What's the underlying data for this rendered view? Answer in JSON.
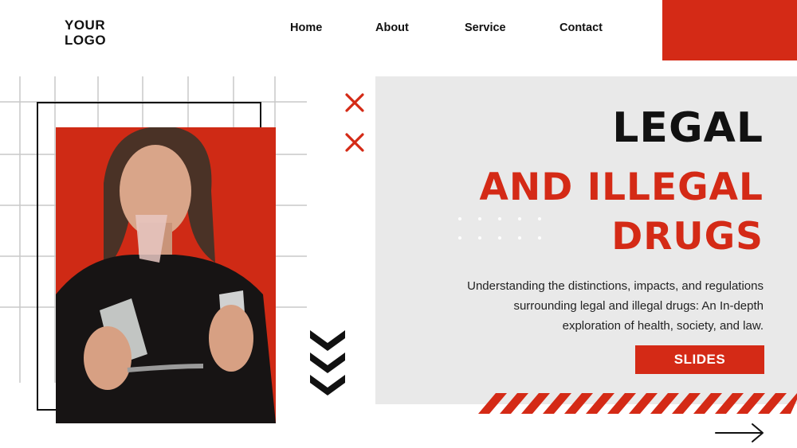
{
  "header": {
    "logo_line1": "YOUR",
    "logo_line2": "LOGO",
    "nav": [
      {
        "label": "Home"
      },
      {
        "label": "About"
      },
      {
        "label": "Service"
      },
      {
        "label": "Contact"
      }
    ]
  },
  "hero": {
    "title_line1": "LEGAL",
    "title_line2": "AND ILLEGAL",
    "title_line3": "DRUGS",
    "description_line1": "Understanding the distinctions, impacts, and regulations",
    "description_line2": "surrounding legal and illegal drugs: An In-depth",
    "description_line3": "exploration of health, society, and law.",
    "button_label": "SLIDES"
  },
  "icons": {
    "x_marks": "close-icon",
    "chevrons": "chevron-down-icon",
    "next": "arrow-right-icon"
  },
  "colors": {
    "accent": "#d42a16",
    "panel": "#e9e9e9",
    "text": "#111111"
  }
}
